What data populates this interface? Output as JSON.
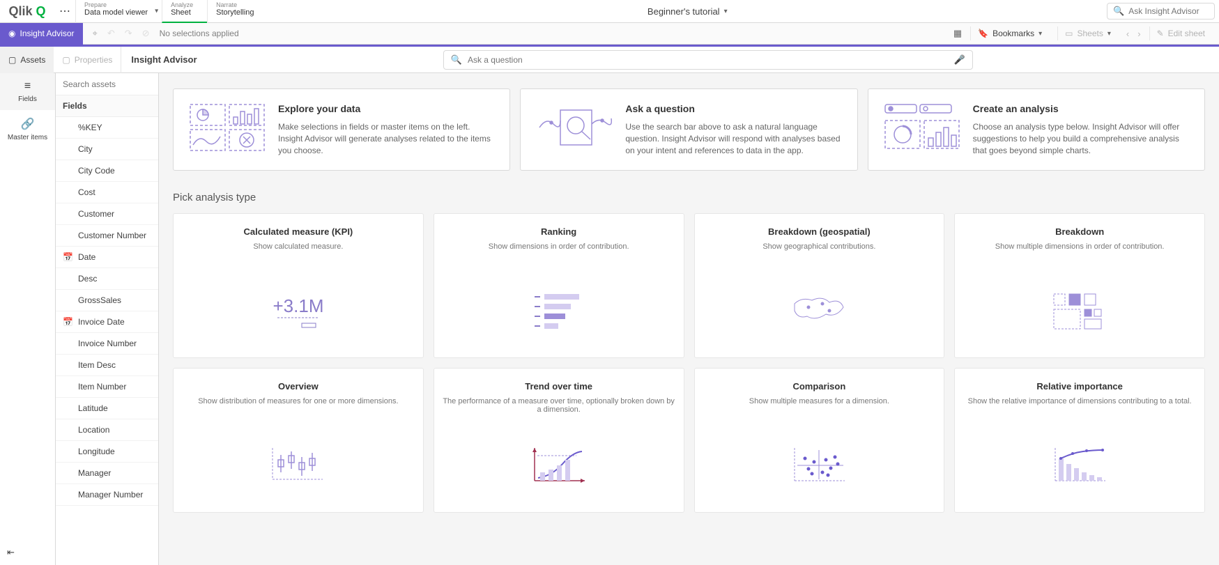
{
  "top": {
    "logo": "Qlik",
    "nav": [
      {
        "sub": "Prepare",
        "main": "Data model viewer",
        "dropdown": true
      },
      {
        "sub": "Analyze",
        "main": "Sheet",
        "active": true
      },
      {
        "sub": "Narrate",
        "main": "Storytelling"
      }
    ],
    "center_title": "Beginner's tutorial",
    "ask_placeholder": "Ask Insight Advisor"
  },
  "selbar": {
    "insight_label": "Insight Advisor",
    "no_selections": "No selections applied",
    "bookmarks": "Bookmarks",
    "sheets": "Sheets",
    "edit": "Edit sheet"
  },
  "subheader": {
    "assets": "Assets",
    "properties": "Properties",
    "title": "Insight Advisor",
    "search_placeholder": "Ask a question"
  },
  "vstrip": {
    "fields": "Fields",
    "master": "Master items"
  },
  "assets": {
    "search_placeholder": "Search assets",
    "header": "Fields",
    "items": [
      {
        "label": "%KEY"
      },
      {
        "label": "City"
      },
      {
        "label": "City Code"
      },
      {
        "label": "Cost"
      },
      {
        "label": "Customer"
      },
      {
        "label": "Customer Number"
      },
      {
        "label": "Date",
        "icon": "calendar"
      },
      {
        "label": "Desc"
      },
      {
        "label": "GrossSales"
      },
      {
        "label": "Invoice Date",
        "icon": "calendar"
      },
      {
        "label": "Invoice Number"
      },
      {
        "label": "Item Desc"
      },
      {
        "label": "Item Number"
      },
      {
        "label": "Latitude"
      },
      {
        "label": "Location"
      },
      {
        "label": "Longitude"
      },
      {
        "label": "Manager"
      },
      {
        "label": "Manager Number"
      }
    ]
  },
  "intro": [
    {
      "title": "Explore your data",
      "desc": "Make selections in fields or master items on the left. Insight Advisor will generate analyses related to the items you choose."
    },
    {
      "title": "Ask a question",
      "desc": "Use the search bar above to ask a natural language question. Insight Advisor will respond with analyses based on your intent and references to data in the app."
    },
    {
      "title": "Create an analysis",
      "desc": "Choose an analysis type below. Insight Advisor will offer suggestions to help you build a comprehensive analysis that goes beyond simple charts."
    }
  ],
  "section_title": "Pick analysis type",
  "analysis": [
    {
      "title": "Calculated measure (KPI)",
      "desc": "Show calculated measure.",
      "viz": "kpi"
    },
    {
      "title": "Ranking",
      "desc": "Show dimensions in order of contribution.",
      "viz": "ranking"
    },
    {
      "title": "Breakdown (geospatial)",
      "desc": "Show geographical contributions.",
      "viz": "geo"
    },
    {
      "title": "Breakdown",
      "desc": "Show multiple dimensions in order of contribution.",
      "viz": "breakdown"
    },
    {
      "title": "Overview",
      "desc": "Show distribution of measures for one or more dimensions.",
      "viz": "overview"
    },
    {
      "title": "Trend over time",
      "desc": "The performance of a measure over time, optionally broken down by a dimension.",
      "viz": "trend"
    },
    {
      "title": "Comparison",
      "desc": "Show multiple measures for a dimension.",
      "viz": "comparison"
    },
    {
      "title": "Relative importance",
      "desc": "Show the relative importance of dimensions contributing to a total.",
      "viz": "pareto"
    }
  ]
}
